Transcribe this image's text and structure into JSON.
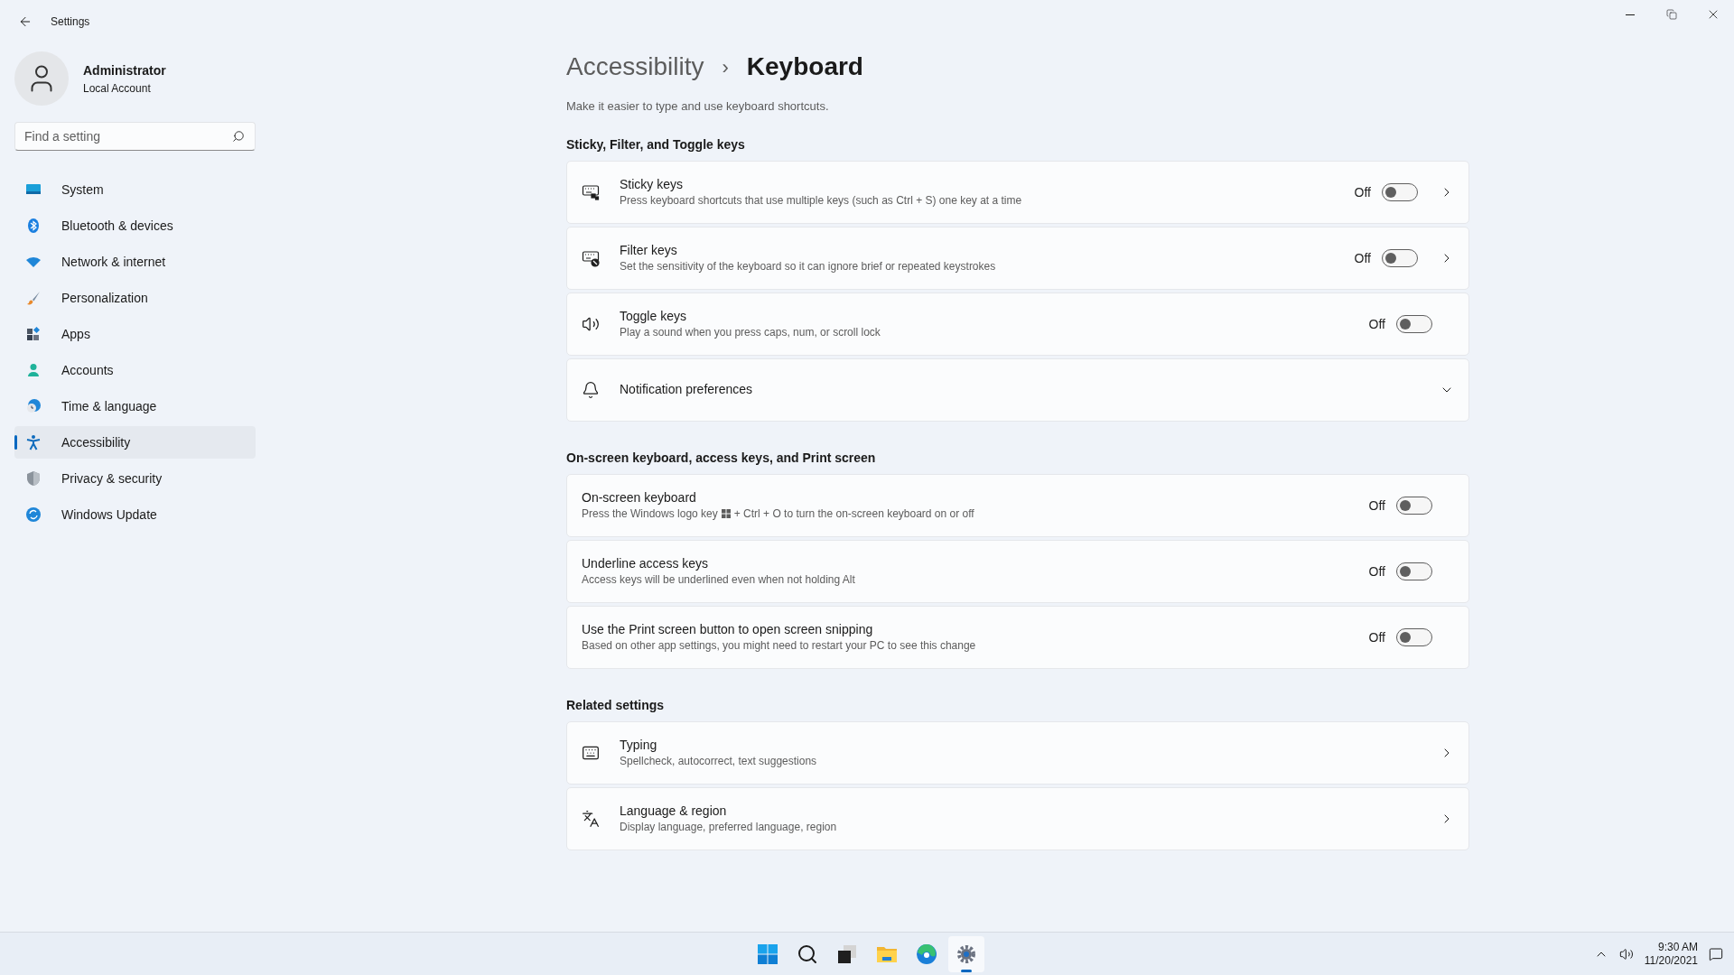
{
  "window": {
    "title": "Settings"
  },
  "account": {
    "name": "Administrator",
    "type": "Local Account"
  },
  "search": {
    "placeholder": "Find a setting"
  },
  "sidebar": {
    "items": [
      {
        "label": "System",
        "selected": false
      },
      {
        "label": "Bluetooth & devices",
        "selected": false
      },
      {
        "label": "Network & internet",
        "selected": false
      },
      {
        "label": "Personalization",
        "selected": false
      },
      {
        "label": "Apps",
        "selected": false
      },
      {
        "label": "Accounts",
        "selected": false
      },
      {
        "label": "Time & language",
        "selected": false
      },
      {
        "label": "Accessibility",
        "selected": true
      },
      {
        "label": "Privacy & security",
        "selected": false
      },
      {
        "label": "Windows Update",
        "selected": false
      }
    ]
  },
  "breadcrumb": {
    "parent": "Accessibility",
    "separator": "›",
    "current": "Keyboard"
  },
  "subtitle": "Make it easier to type and use keyboard shortcuts.",
  "sections": [
    {
      "heading": "Sticky, Filter, and Toggle keys",
      "items": [
        {
          "kind": "toggle_link",
          "title": "Sticky keys",
          "description": "Press keyboard shortcuts that use multiple keys (such as Ctrl + S) one key at a time",
          "state_label": "Off",
          "on": false
        },
        {
          "kind": "toggle_link",
          "title": "Filter keys",
          "description": "Set the sensitivity of the keyboard so it can ignore brief or repeated keystrokes",
          "state_label": "Off",
          "on": false
        },
        {
          "kind": "toggle",
          "title": "Toggle keys",
          "description": "Play a sound when you press caps, num, or scroll lock",
          "state_label": "Off",
          "on": false
        },
        {
          "kind": "expander",
          "title": "Notification preferences",
          "expanded": false
        }
      ]
    },
    {
      "heading": "On-screen keyboard, access keys, and Print screen",
      "items": [
        {
          "kind": "toggle",
          "title": "On-screen keyboard",
          "description": "Press the Windows logo key",
          "description_after": "+ Ctrl + O to turn the on-screen keyboard on or off",
          "state_label": "Off",
          "on": false
        },
        {
          "kind": "toggle",
          "title": "Underline access keys",
          "description": "Access keys will be underlined even when not holding Alt",
          "state_label": "Off",
          "on": false
        },
        {
          "kind": "toggle",
          "title": "Use the Print screen button to open screen snipping",
          "description": "Based on other app settings, you might need to restart your PC to see this change",
          "state_label": "Off",
          "on": false
        }
      ]
    },
    {
      "heading": "Related settings",
      "items": [
        {
          "kind": "link",
          "title": "Typing",
          "description": "Spellcheck, autocorrect, text suggestions"
        },
        {
          "kind": "link",
          "title": "Language & region",
          "description": "Display language, preferred language, region"
        }
      ]
    }
  ],
  "taskbar": {
    "apps": [
      {
        "selected": false
      },
      {
        "selected": false
      },
      {
        "selected": false
      },
      {
        "selected": false
      },
      {
        "selected": false
      },
      {
        "selected": true
      }
    ],
    "time": "9:30 AM",
    "date": "11/20/2021"
  }
}
